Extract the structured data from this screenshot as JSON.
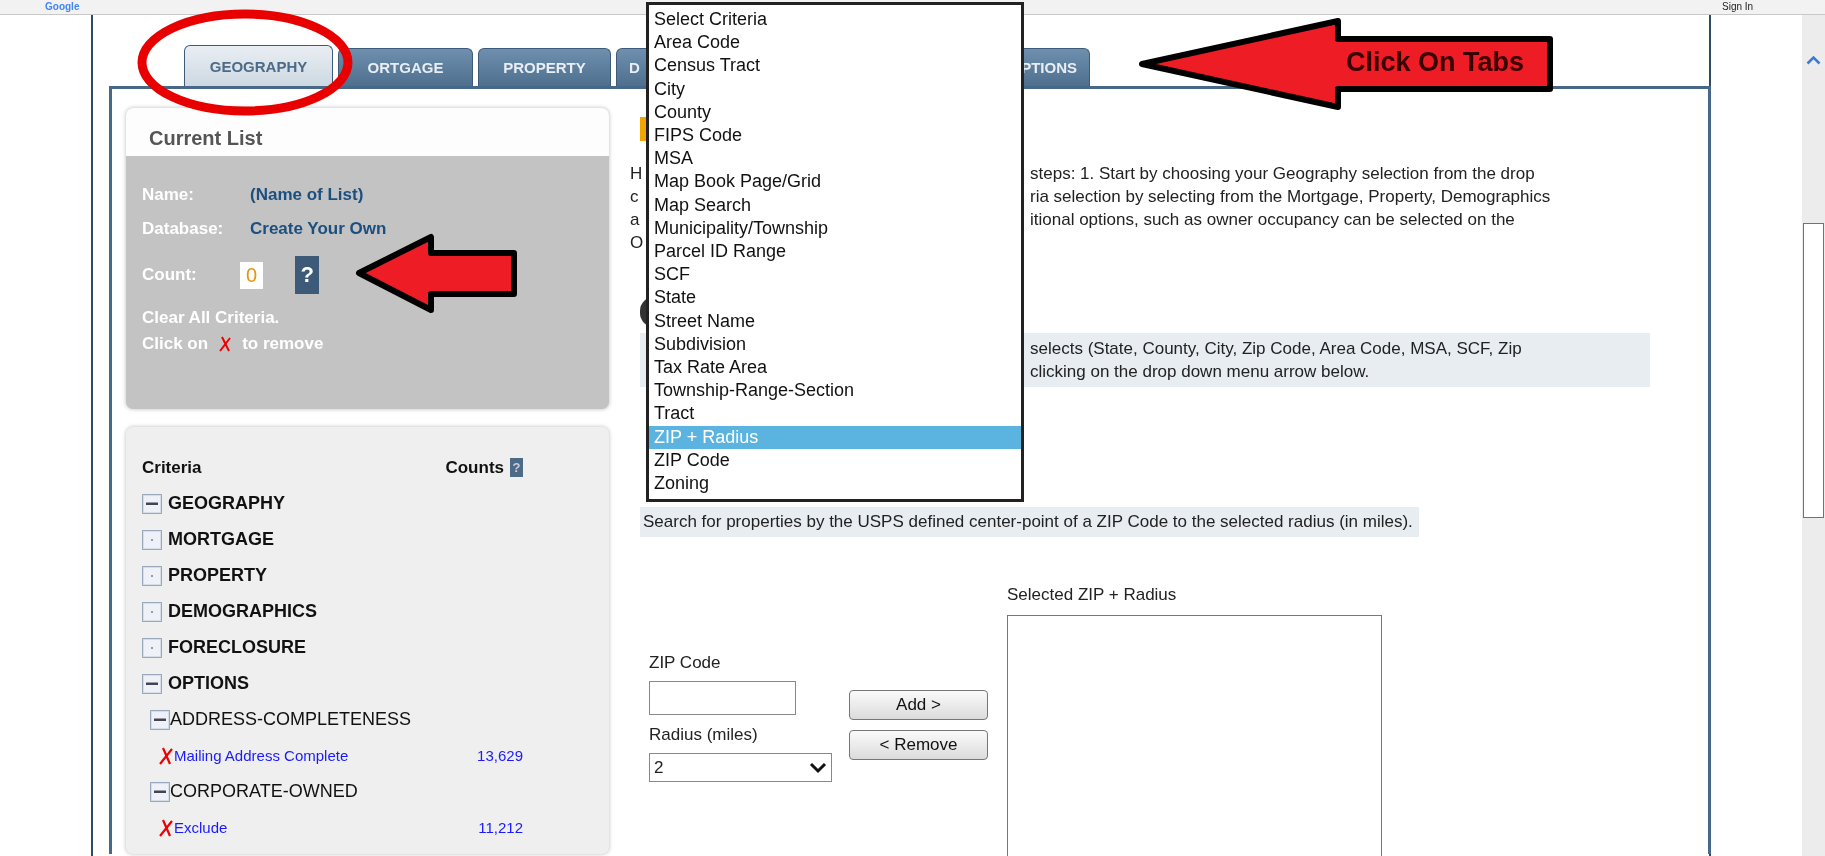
{
  "browser_toolbar": {
    "logo": "Google",
    "sign_in": "Sign In"
  },
  "tabs": [
    {
      "label": "GEOGRAPHY",
      "selected": true
    },
    {
      "label": "ORTGAGE",
      "selected": false
    },
    {
      "label": "PROPERTY",
      "selected": false
    },
    {
      "label": "D",
      "selected": false
    },
    {
      "label": "PTIONS",
      "selected": false
    }
  ],
  "current_list": {
    "title": "Current List",
    "fields": [
      {
        "label": "Name:",
        "value": "(Name of List)"
      },
      {
        "label": "Database:",
        "value": "Create Your Own"
      }
    ],
    "count_label": "Count:",
    "count": "0",
    "help": "?",
    "clear_all": "Clear All Criteria.",
    "remove_hint_before": "Click on",
    "remove_hint_after": "to remove"
  },
  "criteria": {
    "heading": "Criteria",
    "counts_heading": "Counts",
    "help": "?",
    "groups": [
      {
        "label": "GEOGRAPHY",
        "expanded": true
      },
      {
        "label": "MORTGAGE",
        "expanded": false
      },
      {
        "label": "PROPERTY",
        "expanded": false
      },
      {
        "label": "DEMOGRAPHICS",
        "expanded": false
      },
      {
        "label": "FORECLOSURE",
        "expanded": false
      },
      {
        "label": "OPTIONS",
        "expanded": true,
        "children": [
          {
            "label": "ADDRESS-COMPLETENESS",
            "expanded": true,
            "children": [
              {
                "label": "Mailing Address Complete",
                "count": "13,629"
              }
            ]
          },
          {
            "label": "CORPORATE-OWNED",
            "expanded": true,
            "children": [
              {
                "label": "Exclude",
                "count": "11,212"
              }
            ]
          }
        ]
      }
    ]
  },
  "intro": {
    "left_fragments": [
      "H",
      "c",
      "a",
      "O"
    ],
    "lines": [
      "steps: 1. Start by choosing your Geography selection from the drop",
      "ria selection by selecting from the Mortgage, Property, Demographics",
      "itional options, such as owner occupancy can be selected on the"
    ]
  },
  "hint": {
    "lines": [
      "selects (State, County, City, Zip Code, Area Code, MSA, SCF, Zip",
      "clicking on the drop down menu arrow below."
    ]
  },
  "criteria_dropdown": {
    "options": [
      {
        "label": "Select Criteria",
        "selected": false
      },
      {
        "label": "Area Code",
        "selected": false
      },
      {
        "label": "Census Tract",
        "selected": false
      },
      {
        "label": "City",
        "selected": false
      },
      {
        "label": "County",
        "selected": false
      },
      {
        "label": "FIPS Code",
        "selected": false
      },
      {
        "label": "MSA",
        "selected": false
      },
      {
        "label": "Map Book Page/Grid",
        "selected": false
      },
      {
        "label": "Map Search",
        "selected": false
      },
      {
        "label": "Municipality/Township",
        "selected": false
      },
      {
        "label": "Parcel ID Range",
        "selected": false
      },
      {
        "label": "SCF",
        "selected": false
      },
      {
        "label": "State",
        "selected": false
      },
      {
        "label": "Street Name",
        "selected": false
      },
      {
        "label": "Subdivision",
        "selected": false
      },
      {
        "label": "Tax Rate Area",
        "selected": false
      },
      {
        "label": "Township-Range-Section",
        "selected": false
      },
      {
        "label": "Tract",
        "selected": false
      },
      {
        "label": "ZIP + Radius",
        "selected": true
      },
      {
        "label": "ZIP Code",
        "selected": false
      },
      {
        "label": "Zoning",
        "selected": false
      }
    ]
  },
  "description": "Search for properties by the USPS defined center-point of a ZIP Code to the selected radius (in miles).",
  "zip_form": {
    "zip_label": "ZIP Code",
    "radius_label": "Radius (miles)",
    "radius_value": "2",
    "add_button": "Add >",
    "remove_button": "< Remove",
    "selected_label": "Selected ZIP + Radius"
  },
  "callout": {
    "text": "Click On Tabs"
  }
}
